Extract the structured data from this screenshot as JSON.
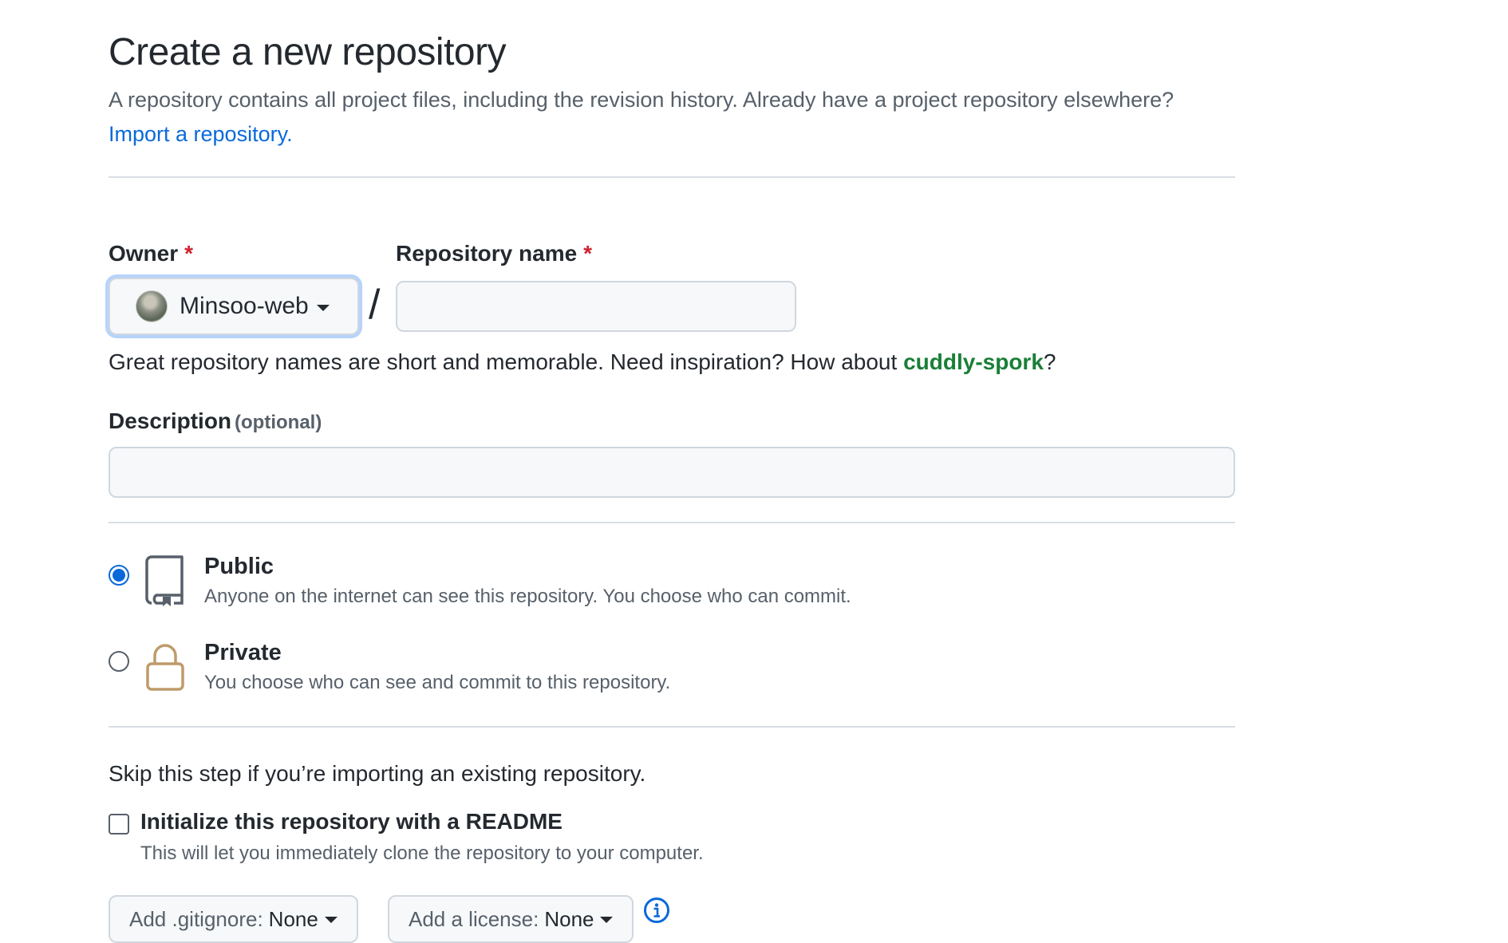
{
  "header": {
    "title": "Create a new repository",
    "subtitle": "A repository contains all project files, including the revision history. Already have a project repository elsewhere?",
    "import_link": "Import a repository."
  },
  "owner": {
    "label": "Owner",
    "required_mark": "*",
    "value": "Minsoo-web"
  },
  "repo_name": {
    "label": "Repository name",
    "required_mark": "*",
    "value": "",
    "separator": "/"
  },
  "hint": {
    "prefix": "Great repository names are short and memorable. Need inspiration? How about",
    "suggestion": "cuddly-spork",
    "suffix": "?"
  },
  "description": {
    "label": "Description",
    "optional": "(optional)",
    "value": ""
  },
  "visibility": {
    "selected": "public",
    "public": {
      "title": "Public",
      "description": "Anyone on the internet can see this repository. You choose who can commit."
    },
    "private": {
      "title": "Private",
      "description": "You choose who can see and commit to this repository."
    }
  },
  "init": {
    "skip_text": "Skip this step if you’re importing an existing repository.",
    "readme_label": "Initialize this repository with a README",
    "readme_desc": "This will let you immediately clone the repository to your computer.",
    "readme_checked": false
  },
  "gitignore": {
    "label": "Add .gitignore:",
    "value": "None"
  },
  "license": {
    "label": "Add a license:",
    "value": "None"
  },
  "icons": {
    "public": "repo-icon",
    "private": "lock-icon",
    "info": "info-icon",
    "caret": "caret-down-icon"
  },
  "colors": {
    "link": "#0969da",
    "required": "#cf222e",
    "suggestion": "#1a7f37",
    "lock": "#bf9b6a",
    "focus_ring": "#b6d4fb"
  }
}
